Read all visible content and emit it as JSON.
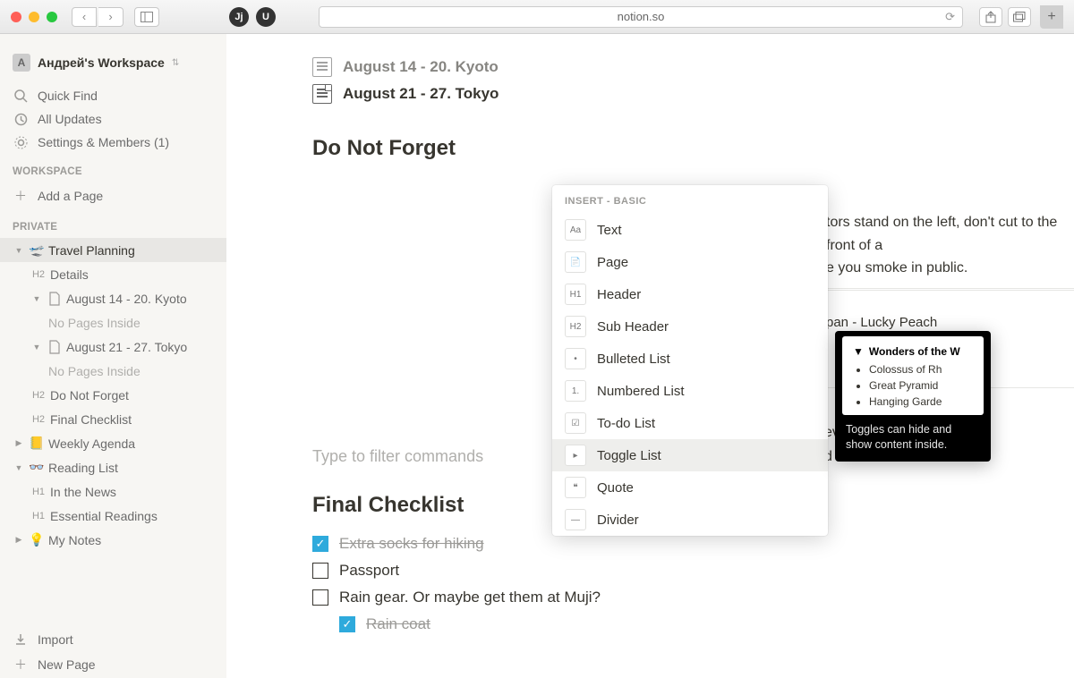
{
  "browser": {
    "url": "notion.so",
    "ext1": "Jj",
    "ext2": "U"
  },
  "workspace": {
    "name": "Андрей's Workspace",
    "avatar_letter": "A"
  },
  "sidebar_top": {
    "quick_find": "Quick Find",
    "all_updates": "All Updates",
    "settings": "Settings & Members (1)"
  },
  "sections": {
    "workspace": "WORKSPACE",
    "private": "PRIVATE"
  },
  "add_page": "Add a Page",
  "tree": {
    "travel": "Travel Planning",
    "details": "Details",
    "kyoto": "August 14 - 20. Kyoto",
    "no_pages": "No Pages Inside",
    "tokyo": "August 21 - 27. Tokyo",
    "dnf": "Do Not Forget",
    "final": "Final Checklist",
    "weekly": "Weekly Agenda",
    "reading": "Reading List",
    "news": "In the News",
    "essential": "Essential Readings",
    "notes": "My Notes",
    "h1": "H1",
    "h2": "H2"
  },
  "sidebar_bottom": {
    "import": "Import",
    "new_page": "New Page"
  },
  "doc": {
    "link1": "August 14 - 20. Kyoto",
    "link2": "August 21 - 27. Tokyo",
    "h_dnf": "Do Not Forget",
    "body_frag1": "tors stand on the left, don't cut to the front of a",
    "body_frag2": "e you smoke in public.",
    "bookmark_title": "pan - Lucky Peach",
    "body_frag3": "ever leave them planted",
    "body_frag4": "d to someone else.",
    "filter": "Type to filter commands",
    "h_final": "Final Checklist"
  },
  "checklist": [
    {
      "label": "Extra socks for hiking",
      "checked": true
    },
    {
      "label": "Passport",
      "checked": false
    },
    {
      "label": "Rain gear. Or maybe get them at Muji?",
      "checked": false
    },
    {
      "label": "Rain coat",
      "checked": true,
      "sub": true
    }
  ],
  "insert_menu": {
    "header": "INSERT - BASIC",
    "items": [
      {
        "icon": "Aa",
        "label": "Text"
      },
      {
        "icon": "📄",
        "label": "Page"
      },
      {
        "icon": "H1",
        "label": "Header"
      },
      {
        "icon": "H2",
        "label": "Sub Header"
      },
      {
        "icon": "•",
        "label": "Bulleted List"
      },
      {
        "icon": "1.",
        "label": "Numbered List"
      },
      {
        "icon": "☑",
        "label": "To-do List"
      },
      {
        "icon": "▸",
        "label": "Toggle List",
        "highlighted": true
      },
      {
        "icon": "❝",
        "label": "Quote"
      },
      {
        "icon": "—",
        "label": "Divider"
      }
    ]
  },
  "tooltip": {
    "title": "Wonders of the W",
    "items": [
      "Colossus of Rh",
      "Great Pyramid",
      "Hanging Garde"
    ],
    "text": "Toggles can hide and show content inside."
  }
}
